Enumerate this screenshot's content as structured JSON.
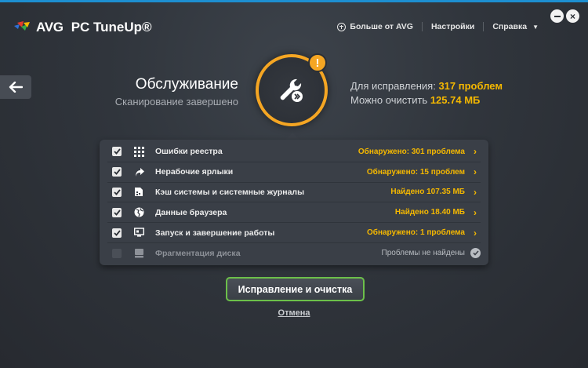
{
  "header": {
    "brand": "AVG",
    "product": "PC TuneUp®",
    "nav": [
      {
        "label": "Больше от AVG",
        "icon": "plus-circle-icon"
      },
      {
        "label": "Настройки"
      },
      {
        "label": "Справка",
        "caret": "▼"
      }
    ]
  },
  "summary": {
    "title": "Обслуживание",
    "subtitle": "Сканирование завершено",
    "to_fix_label": "Для исправления:",
    "to_fix_value": "317 проблем",
    "cleanable_label": "Можно очистить",
    "cleanable_value": "125.74 МБ",
    "alert_glyph": "!"
  },
  "items": [
    {
      "label": "Ошибки реестра",
      "status": "Обнаружено: 301 проблема",
      "checked": true,
      "icon": "grid-icon"
    },
    {
      "label": "Нерабочие ярлыки",
      "status": "Обнаружено: 15 проблем",
      "checked": true,
      "icon": "shortcut-arrow-icon"
    },
    {
      "label": "Кэш системы и системные журналы",
      "status": "Найдено 107.35 МБ",
      "checked": true,
      "icon": "cache-file-icon"
    },
    {
      "label": "Данные браузера",
      "status": "Найдено 18.40 МБ",
      "checked": true,
      "icon": "globe-icon"
    },
    {
      "label": "Запуск и завершение работы",
      "status": "Обнаружено: 1 проблема",
      "checked": true,
      "icon": "monitor-icon"
    },
    {
      "label": "Фрагментация диска",
      "status": "Проблемы не найдены",
      "checked": false,
      "icon": "disk-icon"
    }
  ],
  "actions": {
    "fix_label": "Исправление и очистка",
    "cancel_label": "Отмена"
  },
  "colors": {
    "accent": "#f5a623",
    "highlight": "#f5b800",
    "button_border": "#6cc04a",
    "top_bar": "#1d8fd1"
  }
}
